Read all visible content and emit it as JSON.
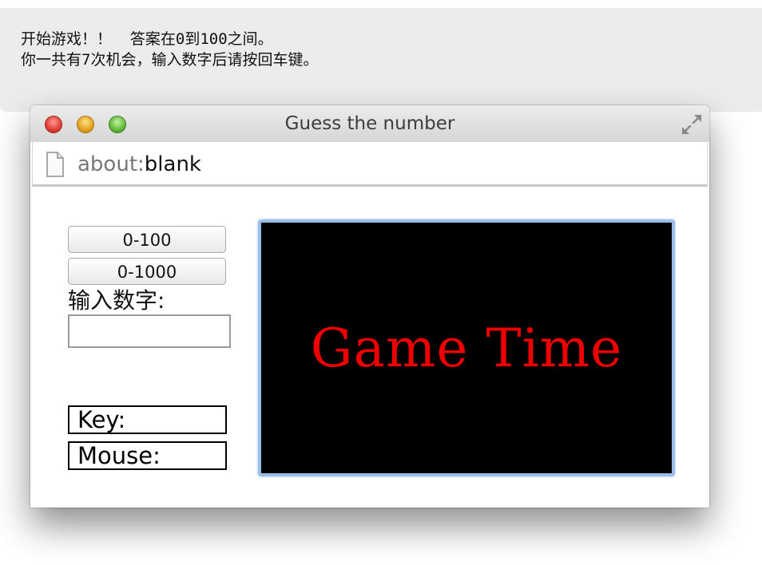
{
  "instructions": {
    "line1": "开始游戏！！  答案在0到100之间。",
    "line2": "你一共有7次机会，输入数字后请按回车键。"
  },
  "window": {
    "title": "Guess the number",
    "url_scheme": "about:",
    "url_path": "blank"
  },
  "controls": {
    "range_small_label": "0-100",
    "range_large_label": "0-1000",
    "input_label": "输入数字:",
    "input_value": "",
    "input_placeholder": "",
    "key_label": "Key:",
    "mouse_label": "Mouse:"
  },
  "canvas": {
    "text": "Game Time",
    "background": "#000000",
    "text_color": "#ee0000"
  },
  "icons": {
    "close": "close-light-icon",
    "minimize": "minimize-light-icon",
    "maximize": "zoom-light-icon",
    "fullscreen": "fullscreen-arrows-icon",
    "page": "blank-page-icon"
  }
}
